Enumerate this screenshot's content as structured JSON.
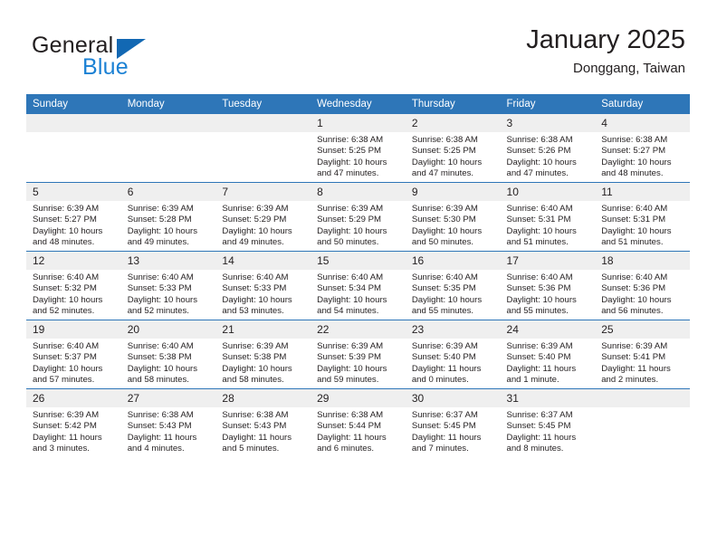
{
  "brand": {
    "name_part1": "General",
    "name_part2": "Blue",
    "triangle_icon": "blue-triangle-icon",
    "accent_color": "#1b81d4"
  },
  "header": {
    "title": "January 2025",
    "subtitle": "Donggang, Taiwan"
  },
  "theme": {
    "header_blue": "#2e76b8",
    "daynum_gray": "#efefef",
    "text": "#231f20"
  },
  "weekdays": [
    "Sunday",
    "Monday",
    "Tuesday",
    "Wednesday",
    "Thursday",
    "Friday",
    "Saturday"
  ],
  "labels": {
    "sunrise": "Sunrise:",
    "sunset": "Sunset:",
    "daylight": "Daylight:"
  },
  "weeks": [
    [
      {
        "day": "",
        "empty": true
      },
      {
        "day": "",
        "empty": true
      },
      {
        "day": "",
        "empty": true
      },
      {
        "day": "1",
        "sunrise": "Sunrise: 6:38 AM",
        "sunset": "Sunset: 5:25 PM",
        "daylight_1": "Daylight: 10 hours",
        "daylight_2": "and 47 minutes."
      },
      {
        "day": "2",
        "sunrise": "Sunrise: 6:38 AM",
        "sunset": "Sunset: 5:25 PM",
        "daylight_1": "Daylight: 10 hours",
        "daylight_2": "and 47 minutes."
      },
      {
        "day": "3",
        "sunrise": "Sunrise: 6:38 AM",
        "sunset": "Sunset: 5:26 PM",
        "daylight_1": "Daylight: 10 hours",
        "daylight_2": "and 47 minutes."
      },
      {
        "day": "4",
        "sunrise": "Sunrise: 6:38 AM",
        "sunset": "Sunset: 5:27 PM",
        "daylight_1": "Daylight: 10 hours",
        "daylight_2": "and 48 minutes."
      }
    ],
    [
      {
        "day": "5",
        "sunrise": "Sunrise: 6:39 AM",
        "sunset": "Sunset: 5:27 PM",
        "daylight_1": "Daylight: 10 hours",
        "daylight_2": "and 48 minutes."
      },
      {
        "day": "6",
        "sunrise": "Sunrise: 6:39 AM",
        "sunset": "Sunset: 5:28 PM",
        "daylight_1": "Daylight: 10 hours",
        "daylight_2": "and 49 minutes."
      },
      {
        "day": "7",
        "sunrise": "Sunrise: 6:39 AM",
        "sunset": "Sunset: 5:29 PM",
        "daylight_1": "Daylight: 10 hours",
        "daylight_2": "and 49 minutes."
      },
      {
        "day": "8",
        "sunrise": "Sunrise: 6:39 AM",
        "sunset": "Sunset: 5:29 PM",
        "daylight_1": "Daylight: 10 hours",
        "daylight_2": "and 50 minutes."
      },
      {
        "day": "9",
        "sunrise": "Sunrise: 6:39 AM",
        "sunset": "Sunset: 5:30 PM",
        "daylight_1": "Daylight: 10 hours",
        "daylight_2": "and 50 minutes."
      },
      {
        "day": "10",
        "sunrise": "Sunrise: 6:40 AM",
        "sunset": "Sunset: 5:31 PM",
        "daylight_1": "Daylight: 10 hours",
        "daylight_2": "and 51 minutes."
      },
      {
        "day": "11",
        "sunrise": "Sunrise: 6:40 AM",
        "sunset": "Sunset: 5:31 PM",
        "daylight_1": "Daylight: 10 hours",
        "daylight_2": "and 51 minutes."
      }
    ],
    [
      {
        "day": "12",
        "sunrise": "Sunrise: 6:40 AM",
        "sunset": "Sunset: 5:32 PM",
        "daylight_1": "Daylight: 10 hours",
        "daylight_2": "and 52 minutes."
      },
      {
        "day": "13",
        "sunrise": "Sunrise: 6:40 AM",
        "sunset": "Sunset: 5:33 PM",
        "daylight_1": "Daylight: 10 hours",
        "daylight_2": "and 52 minutes."
      },
      {
        "day": "14",
        "sunrise": "Sunrise: 6:40 AM",
        "sunset": "Sunset: 5:33 PM",
        "daylight_1": "Daylight: 10 hours",
        "daylight_2": "and 53 minutes."
      },
      {
        "day": "15",
        "sunrise": "Sunrise: 6:40 AM",
        "sunset": "Sunset: 5:34 PM",
        "daylight_1": "Daylight: 10 hours",
        "daylight_2": "and 54 minutes."
      },
      {
        "day": "16",
        "sunrise": "Sunrise: 6:40 AM",
        "sunset": "Sunset: 5:35 PM",
        "daylight_1": "Daylight: 10 hours",
        "daylight_2": "and 55 minutes."
      },
      {
        "day": "17",
        "sunrise": "Sunrise: 6:40 AM",
        "sunset": "Sunset: 5:36 PM",
        "daylight_1": "Daylight: 10 hours",
        "daylight_2": "and 55 minutes."
      },
      {
        "day": "18",
        "sunrise": "Sunrise: 6:40 AM",
        "sunset": "Sunset: 5:36 PM",
        "daylight_1": "Daylight: 10 hours",
        "daylight_2": "and 56 minutes."
      }
    ],
    [
      {
        "day": "19",
        "sunrise": "Sunrise: 6:40 AM",
        "sunset": "Sunset: 5:37 PM",
        "daylight_1": "Daylight: 10 hours",
        "daylight_2": "and 57 minutes."
      },
      {
        "day": "20",
        "sunrise": "Sunrise: 6:40 AM",
        "sunset": "Sunset: 5:38 PM",
        "daylight_1": "Daylight: 10 hours",
        "daylight_2": "and 58 minutes."
      },
      {
        "day": "21",
        "sunrise": "Sunrise: 6:39 AM",
        "sunset": "Sunset: 5:38 PM",
        "daylight_1": "Daylight: 10 hours",
        "daylight_2": "and 58 minutes."
      },
      {
        "day": "22",
        "sunrise": "Sunrise: 6:39 AM",
        "sunset": "Sunset: 5:39 PM",
        "daylight_1": "Daylight: 10 hours",
        "daylight_2": "and 59 minutes."
      },
      {
        "day": "23",
        "sunrise": "Sunrise: 6:39 AM",
        "sunset": "Sunset: 5:40 PM",
        "daylight_1": "Daylight: 11 hours",
        "daylight_2": "and 0 minutes."
      },
      {
        "day": "24",
        "sunrise": "Sunrise: 6:39 AM",
        "sunset": "Sunset: 5:40 PM",
        "daylight_1": "Daylight: 11 hours",
        "daylight_2": "and 1 minute."
      },
      {
        "day": "25",
        "sunrise": "Sunrise: 6:39 AM",
        "sunset": "Sunset: 5:41 PM",
        "daylight_1": "Daylight: 11 hours",
        "daylight_2": "and 2 minutes."
      }
    ],
    [
      {
        "day": "26",
        "sunrise": "Sunrise: 6:39 AM",
        "sunset": "Sunset: 5:42 PM",
        "daylight_1": "Daylight: 11 hours",
        "daylight_2": "and 3 minutes."
      },
      {
        "day": "27",
        "sunrise": "Sunrise: 6:38 AM",
        "sunset": "Sunset: 5:43 PM",
        "daylight_1": "Daylight: 11 hours",
        "daylight_2": "and 4 minutes."
      },
      {
        "day": "28",
        "sunrise": "Sunrise: 6:38 AM",
        "sunset": "Sunset: 5:43 PM",
        "daylight_1": "Daylight: 11 hours",
        "daylight_2": "and 5 minutes."
      },
      {
        "day": "29",
        "sunrise": "Sunrise: 6:38 AM",
        "sunset": "Sunset: 5:44 PM",
        "daylight_1": "Daylight: 11 hours",
        "daylight_2": "and 6 minutes."
      },
      {
        "day": "30",
        "sunrise": "Sunrise: 6:37 AM",
        "sunset": "Sunset: 5:45 PM",
        "daylight_1": "Daylight: 11 hours",
        "daylight_2": "and 7 minutes."
      },
      {
        "day": "31",
        "sunrise": "Sunrise: 6:37 AM",
        "sunset": "Sunset: 5:45 PM",
        "daylight_1": "Daylight: 11 hours",
        "daylight_2": "and 8 minutes."
      },
      {
        "day": "",
        "empty": true
      }
    ]
  ]
}
